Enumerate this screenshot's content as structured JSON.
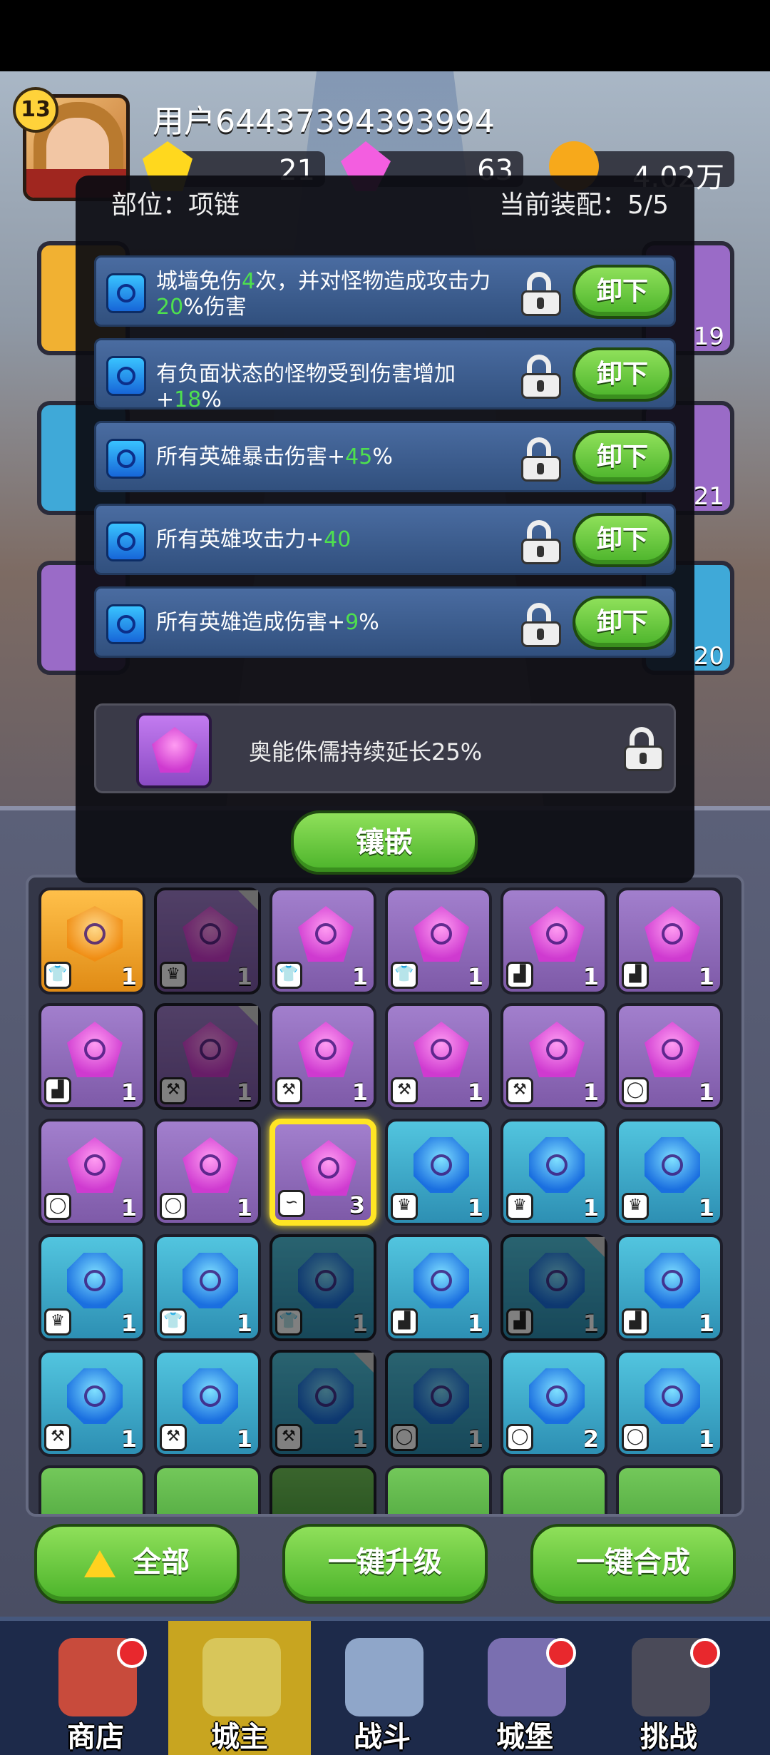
{
  "header": {
    "level": "13",
    "username": "用户64437394393994",
    "gold": "21",
    "gems": "63",
    "coins": "4.02万"
  },
  "heroes": {
    "right_levels": [
      "19",
      "21",
      "20"
    ]
  },
  "dialog": {
    "slot_label": "部位：项链",
    "equip_label": "当前装配：5/5",
    "slots": [
      {
        "pre": "城墙免伤",
        "n1": "4",
        "mid": "次，并对怪物造成攻击力",
        "n2": "20",
        "post": "%伤害",
        "button": "卸下"
      },
      {
        "pre": "有负面状态的怪物受到伤害增加+",
        "n1": "18",
        "mid": "%",
        "n2": "",
        "post": "",
        "button": "卸下"
      },
      {
        "pre": "所有英雄暴击伤害+",
        "n1": "45",
        "mid": "%",
        "n2": "",
        "post": "",
        "button": "卸下"
      },
      {
        "pre": "所有英雄攻击力+",
        "n1": "40",
        "mid": "",
        "n2": "",
        "post": "",
        "button": "卸下"
      },
      {
        "pre": "所有英雄造成伤害+",
        "n1": "9",
        "mid": "%",
        "n2": "",
        "post": "",
        "button": "卸下"
      }
    ],
    "extra": "奥能侏儒持续延长25%",
    "inlay_button": "镶嵌"
  },
  "inventory": {
    "rows": [
      [
        [
          "orange",
          "shirt",
          "1",
          0,
          0
        ],
        [
          "purple",
          "crown",
          "1",
          1,
          1
        ],
        [
          "purple",
          "shirt",
          "1",
          0,
          0
        ],
        [
          "purple",
          "shirt",
          "1",
          0,
          0
        ],
        [
          "purple",
          "boot",
          "1",
          0,
          0
        ],
        [
          "purple",
          "boot",
          "1",
          0,
          0
        ]
      ],
      [
        [
          "purple",
          "boot",
          "1",
          0,
          0
        ],
        [
          "purple",
          "axe",
          "1",
          1,
          1
        ],
        [
          "purple",
          "axe",
          "1",
          0,
          0
        ],
        [
          "purple",
          "axe",
          "1",
          0,
          0
        ],
        [
          "purple",
          "axe",
          "1",
          0,
          0
        ],
        [
          "purple",
          "ring",
          "1",
          0,
          0
        ]
      ],
      [
        [
          "purple",
          "ring",
          "1",
          0,
          0
        ],
        [
          "purple",
          "ring",
          "1",
          0,
          0
        ],
        [
          "purple",
          "whip",
          "3",
          0,
          0
        ],
        [
          "blue",
          "crown",
          "1",
          0,
          0
        ],
        [
          "blue",
          "crown",
          "1",
          0,
          0
        ],
        [
          "blue",
          "crown",
          "1",
          0,
          0
        ]
      ],
      [
        [
          "blue",
          "crown",
          "1",
          0,
          0
        ],
        [
          "blue",
          "shirt",
          "1",
          0,
          0
        ],
        [
          "blue",
          "shirt",
          "1",
          1,
          0
        ],
        [
          "blue",
          "boot",
          "1",
          0,
          0
        ],
        [
          "blue",
          "boot",
          "1",
          1,
          1
        ],
        [
          "blue",
          "boot",
          "1",
          0,
          0
        ]
      ],
      [
        [
          "blue",
          "axe",
          "1",
          0,
          0
        ],
        [
          "blue",
          "axe",
          "1",
          0,
          0
        ],
        [
          "blue",
          "axe",
          "1",
          1,
          1
        ],
        [
          "blue",
          "ring",
          "1",
          1,
          0
        ],
        [
          "blue",
          "ring",
          "2",
          0,
          0
        ],
        [
          "blue",
          "ring",
          "1",
          0,
          0
        ]
      ]
    ]
  },
  "actions": {
    "all": "全部",
    "upgrade": "一键升级",
    "merge": "一键合成"
  },
  "nav": [
    {
      "label": "商店",
      "dot": true,
      "color": "#c84b3c"
    },
    {
      "label": "城主",
      "dot": false,
      "color": "#d8c65a"
    },
    {
      "label": "战斗",
      "dot": false,
      "color": "#8fa6c9"
    },
    {
      "label": "城堡",
      "dot": true,
      "color": "#7a6fb0"
    },
    {
      "label": "挑战",
      "dot": true,
      "color": "#4a4a58"
    }
  ]
}
